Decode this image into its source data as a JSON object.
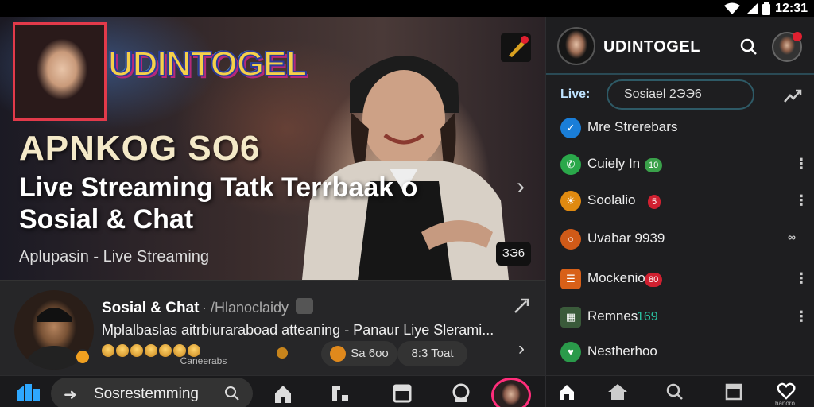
{
  "status_bar": {
    "time": "12:31"
  },
  "hero": {
    "brand_logo": "UDINTOGEL",
    "headline_sub": "APNKOG SO6",
    "headline": "Live Streaming Tatk Terrbaak o Sosial & Chat",
    "caption": "Aplupasin - Live Streaming",
    "counter": "ЗЭ6"
  },
  "card": {
    "title": "Sosial & Chat",
    "handle": "· /Hlanoclaidy",
    "description": "Mplalbaslas aitrbiuraraboad atteaning - Panaur Liye Slerami...",
    "chip_left": "Caneerabs",
    "chip_a": "Sa 6oo",
    "chip_b": "8:3 Toat"
  },
  "bottom_nav": {
    "search_text": "Sosrestemming"
  },
  "panel": {
    "title": "UDINTOGEL",
    "live_label": "Live:",
    "live_input_value": "Sosiael 2ЭЭ6",
    "items": [
      {
        "label": "Mre Strerebars",
        "icon_color": "#1a7ed8",
        "icon": "feather-icon"
      },
      {
        "label": "Cuiely In",
        "icon_color": "#2aa84a",
        "icon": "phone-icon",
        "badge": "10",
        "badge_color": "#3aa14a"
      },
      {
        "label": "Soolalio",
        "icon_color": "#e08a10",
        "icon": "sun-icon",
        "badge": "5",
        "badge_color": "#d02030"
      },
      {
        "label": "Uvabar 9939",
        "icon_color": "#d05a18",
        "icon": "fire-icon"
      },
      {
        "label": "Mockenio",
        "icon_color": "#d86018",
        "icon": "book-icon",
        "badge": "80",
        "badge_color": "#d02030"
      },
      {
        "label": "Remnes",
        "icon_color": "#3a5a3a",
        "icon": "grid-icon",
        "count": "169",
        "count_color": "#2ac0a0"
      },
      {
        "label": "Nestherhoo",
        "icon_color": "#2a9a4a",
        "icon": "heart-icon"
      }
    ],
    "nav_label": "hanoro"
  }
}
